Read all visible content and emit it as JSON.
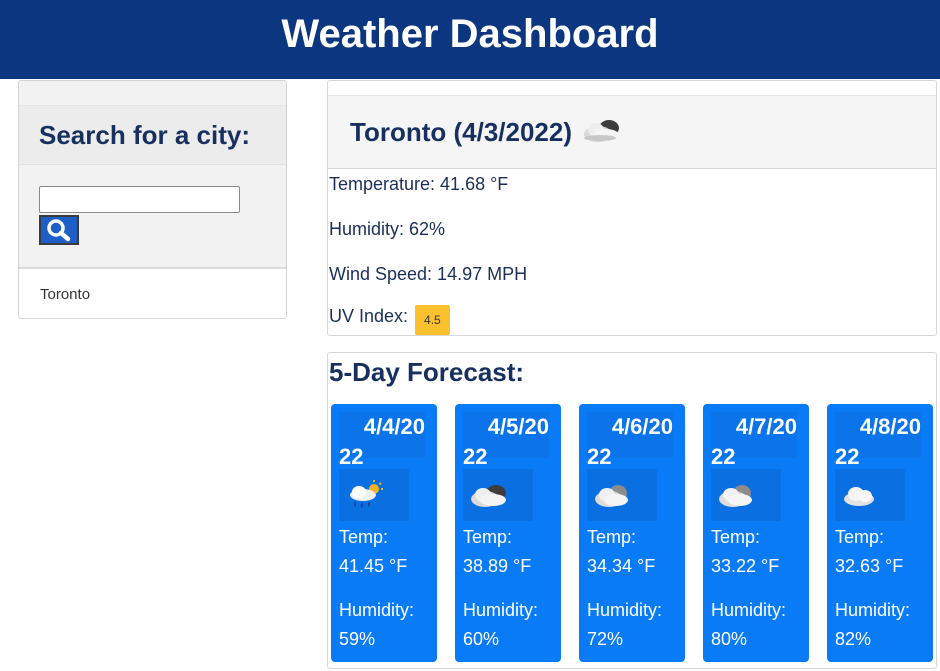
{
  "header": {
    "title": "Weather Dashboard"
  },
  "sidebar": {
    "heading": "Search for a city:",
    "search": {
      "value": "",
      "placeholder": ""
    },
    "history": [
      "Toronto"
    ]
  },
  "current": {
    "title": "Toronto (4/3/2022)",
    "icon": "partly-cloudy-night-icon",
    "temperature": "Temperature: 41.68 °F",
    "humidity": "Humidity: 62%",
    "wind": "Wind Speed: 14.97 MPH",
    "uv_label": "UV Index:",
    "uv_value": "4.5",
    "uv_color": "#fbc02d"
  },
  "forecast": {
    "heading": "5-Day Forecast:",
    "days": [
      {
        "date1": "4/4/20",
        "date2": "22",
        "icon": "rain-sun-icon",
        "temp_label": "Temp:",
        "temp": "41.45 °F",
        "hum_label": "Humidity:",
        "humidity": "59%"
      },
      {
        "date1": "4/5/20",
        "date2": "22",
        "icon": "partly-cloudy-night-icon",
        "temp_label": "Temp:",
        "temp": "38.89 °F",
        "hum_label": "Humidity:",
        "humidity": "60%"
      },
      {
        "date1": "4/6/20",
        "date2": "22",
        "icon": "broken-clouds-icon",
        "temp_label": "Temp:",
        "temp": "34.34 °F",
        "hum_label": "Humidity:",
        "humidity": "72%"
      },
      {
        "date1": "4/7/20",
        "date2": "22",
        "icon": "broken-clouds-icon",
        "temp_label": "Temp:",
        "temp": "33.22 °F",
        "hum_label": "Humidity:",
        "humidity": "80%"
      },
      {
        "date1": "4/8/20",
        "date2": "22",
        "icon": "cloud-icon",
        "temp_label": "Temp:",
        "temp": "32.63 °F",
        "hum_label": "Humidity:",
        "humidity": "82%"
      }
    ]
  },
  "colors": {
    "header": "#0c367f",
    "card": "#0a7bf7",
    "search_button": "#1e5ec7",
    "uv": "#fbc02d"
  }
}
